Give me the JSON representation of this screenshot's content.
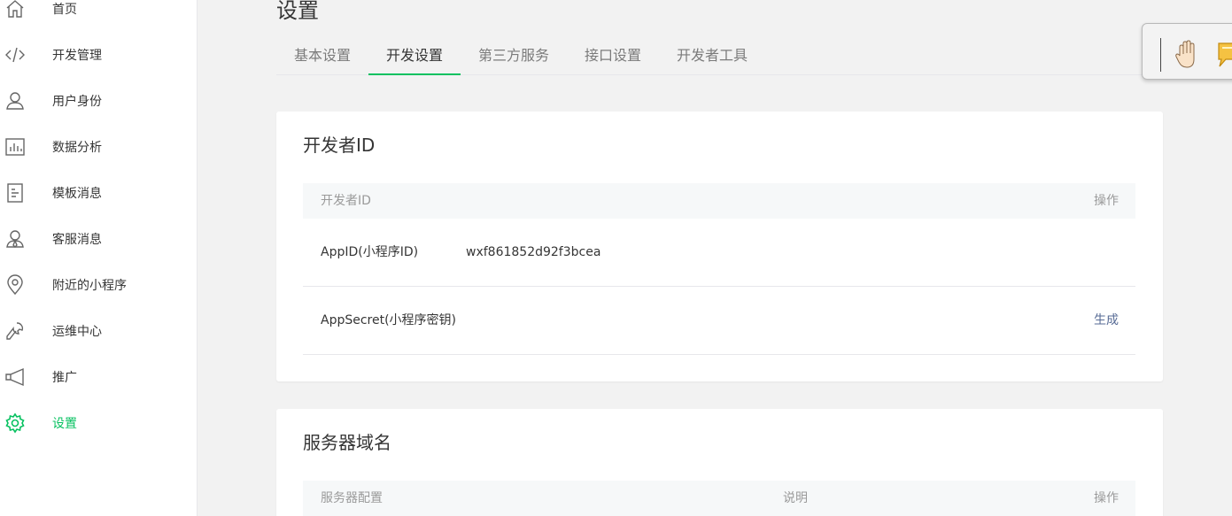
{
  "sidebar": {
    "items": [
      {
        "label": "首页",
        "icon": "home-icon"
      },
      {
        "label": "开发管理",
        "icon": "code-icon"
      },
      {
        "label": "用户身份",
        "icon": "user-icon"
      },
      {
        "label": "数据分析",
        "icon": "bar-chart-icon"
      },
      {
        "label": "模板消息",
        "icon": "document-icon"
      },
      {
        "label": "客服消息",
        "icon": "customer-service-icon"
      },
      {
        "label": "附近的小程序",
        "icon": "location-pin-icon"
      },
      {
        "label": "运维中心",
        "icon": "wrench-icon"
      },
      {
        "label": "推广",
        "icon": "megaphone-icon"
      },
      {
        "label": "设置",
        "icon": "gear-icon",
        "active": true
      }
    ],
    "active_color": "#07c160"
  },
  "page": {
    "title": "设置",
    "tabs": [
      {
        "label": "基本设置"
      },
      {
        "label": "开发设置",
        "active": true
      },
      {
        "label": "第三方服务"
      },
      {
        "label": "接口设置"
      },
      {
        "label": "开发者工具"
      }
    ]
  },
  "developer_id": {
    "title": "开发者ID",
    "header": {
      "col1": "开发者ID",
      "col_action": "操作"
    },
    "rows": [
      {
        "name": "AppID(小程序ID)",
        "value": "wxf861852d92f3bcea",
        "action": ""
      },
      {
        "name": "AppSecret(小程序密钥)",
        "value": "",
        "action": "生成"
      }
    ]
  },
  "server_domain": {
    "title": "服务器域名",
    "header": {
      "col1": "服务器配置",
      "col2": "说明",
      "col_action": "操作"
    }
  },
  "colors": {
    "accent": "#07c160",
    "link": "#576b95"
  }
}
